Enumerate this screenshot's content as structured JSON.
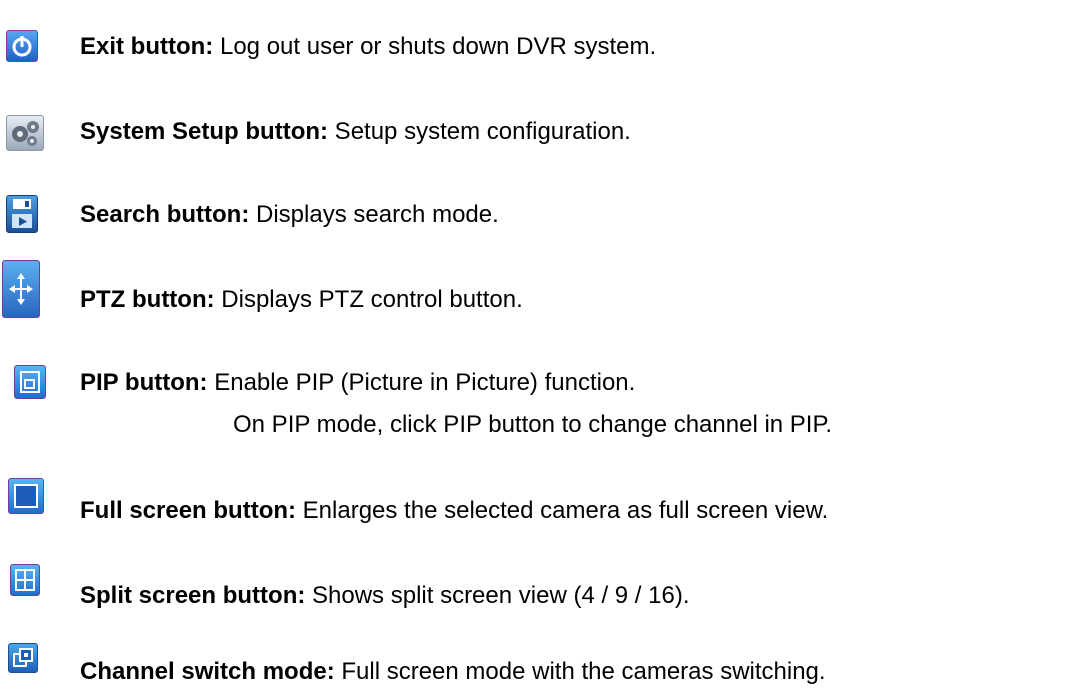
{
  "items": [
    {
      "icon": "power-icon",
      "label": "Exit button:",
      "desc": " Log out user or shuts down DVR system."
    },
    {
      "icon": "gears-icon",
      "label": "System Setup button:",
      "desc": " Setup system configuration."
    },
    {
      "icon": "floppy-play-icon",
      "label": "Search button:",
      "desc": " Displays search mode."
    },
    {
      "icon": "ptz-arrows-icon",
      "label": "PTZ button:",
      "desc": " Displays PTZ control button."
    },
    {
      "icon": "pip-icon",
      "label": "PIP button:",
      "desc": " Enable PIP (Picture in Picture) function.",
      "desc2": "On PIP mode, click PIP button to change channel in PIP."
    },
    {
      "icon": "full-screen-icon",
      "label": "Full screen button:",
      "desc": " Enlarges the selected camera as full screen view."
    },
    {
      "icon": "split-screen-icon",
      "label": "Split screen button:",
      "desc": " Shows split screen view (4 / 9 / 16)."
    },
    {
      "icon": "channel-switch-icon",
      "label": "Channel switch mode:",
      "desc": " Full screen mode with the cameras switching."
    }
  ]
}
